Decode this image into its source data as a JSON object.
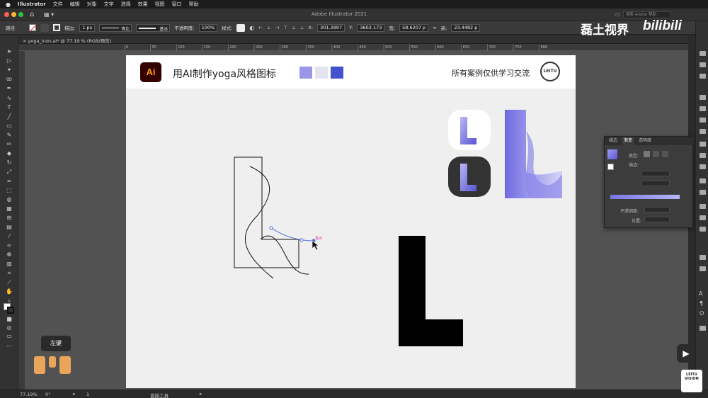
{
  "menubar": {
    "apple": "",
    "app_name": "Illustrator",
    "items": [
      "文件",
      "编辑",
      "对象",
      "文字",
      "选择",
      "效果",
      "视图",
      "窗口",
      "帮助"
    ]
  },
  "app_header": {
    "title": "Adobe Illustrator 2021",
    "search_placeholder": "搜索 Adobe 帮助"
  },
  "control_bar": {
    "selection_type": "路径",
    "stroke_label": "描边:",
    "stroke_weight": "1 px",
    "stroke_profile": "等比",
    "brush": "基本",
    "opacity_label": "不透明度:",
    "opacity_value": "100%",
    "style_label": "样式:",
    "x_label": "X:",
    "x_value": "301.2897",
    "y_label": "Y:",
    "y_value": "3602.173",
    "w_label": "宽:",
    "w_value": "58.6207 p",
    "h_label": "高:",
    "h_value": "23.4482 p"
  },
  "document_tab": {
    "label": "yoga_icon.ai* @ 77.19 % (RGB/预览)"
  },
  "ruler_ticks": [
    "0",
    "50",
    "100",
    "150",
    "200",
    "250",
    "300",
    "350",
    "400",
    "450",
    "500",
    "550",
    "600",
    "650",
    "700",
    "750",
    "800"
  ],
  "banner": {
    "logo_text": "Ai",
    "title": "用AI制作yoga风格图标",
    "swatch_colors": [
      "#9a97e8",
      "#e3e3f0",
      "#4452d0"
    ],
    "note": "所有案例仅供学习交流",
    "seal_text": "LEITU"
  },
  "canvas": {
    "anchor_label": "锚点",
    "icon_gradient": [
      "#5a55d6",
      "#b6b3f2"
    ]
  },
  "gradient_panel": {
    "tabs": [
      "描边",
      "渐变",
      "透明度"
    ],
    "type_label": "类型:",
    "stroke_label": "描边:",
    "opacity_label": "不透明度:",
    "location_label": "位置:"
  },
  "status_bar": {
    "zoom": "77.19%",
    "rotation": "0°",
    "artboard_nav": "1",
    "tool_name": "直接工具"
  },
  "overlay": {
    "mouse_label": "左键",
    "watermark_cn": "磊土视界",
    "watermark_bili": "bilibili",
    "brand_small": "LEITU VISION"
  }
}
